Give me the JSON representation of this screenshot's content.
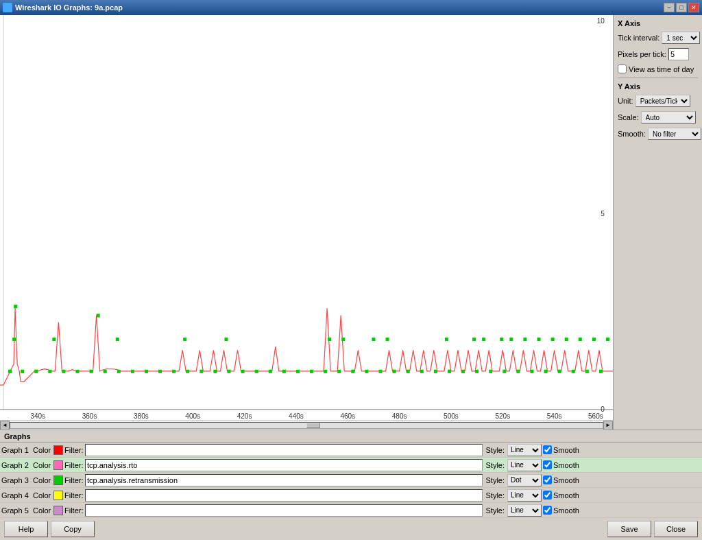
{
  "titleBar": {
    "title": "Wireshark IO Graphs: 9a.pcap",
    "minBtn": "−",
    "maxBtn": "□",
    "closeBtn": "✕"
  },
  "chart": {
    "xAxisLabels": [
      "340s",
      "360s",
      "380s",
      "400s",
      "420s",
      "440s",
      "460s",
      "480s",
      "500s",
      "520s",
      "540s",
      "560s"
    ],
    "yAxisLabels": [
      "10",
      "5",
      "0"
    ]
  },
  "rightPanel": {
    "xAxisTitle": "X Axis",
    "tickIntervalLabel": "Tick interval:",
    "tickIntervalValue": "1 sec",
    "pixelsPerTickLabel": "Pixels per tick:",
    "pixelsPerTickValue": "5",
    "viewAsTimeOfDayLabel": "View as time of day",
    "yAxisTitle": "Y Axis",
    "unitLabel": "Unit:",
    "unitValue": "Packets/Tick",
    "scaleLabel": "Scale:",
    "scaleValue": "Auto",
    "smoothLabel": "Smooth:",
    "smoothValue": "No filter"
  },
  "graphsSection": {
    "title": "Graphs",
    "graphs": [
      {
        "label": "Graph 1",
        "colorLabel": "Color",
        "filterLabel": "Filter:",
        "filterValue": "",
        "styleLabel": "Style:",
        "styleValue": "Line",
        "smoothLabel": "Smooth",
        "smoothChecked": true,
        "colorHex": "#ff0000",
        "selected": false
      },
      {
        "label": "Graph 2",
        "colorLabel": "Color",
        "filterLabel": "Filter:",
        "filterValue": "tcp.analysis.rto",
        "styleLabel": "Style:",
        "styleValue": "Line",
        "smoothLabel": "Smooth",
        "smoothChecked": true,
        "colorHex": "#ff69b4",
        "selected": true
      },
      {
        "label": "Graph 3",
        "colorLabel": "Color",
        "filterLabel": "Filter:",
        "filterValue": "tcp.analysis.retransmission",
        "styleLabel": "Style:",
        "styleValue": "Dot",
        "smoothLabel": "Smooth",
        "smoothChecked": true,
        "colorHex": "#00cc00",
        "selected": false
      },
      {
        "label": "Graph 4",
        "colorLabel": "Color",
        "filterLabel": "Filter:",
        "filterValue": "",
        "styleLabel": "Style:",
        "styleValue": "Line",
        "smoothLabel": "Smooth",
        "smoothChecked": true,
        "colorHex": "#ffff00",
        "selected": false
      },
      {
        "label": "Graph 5",
        "colorLabel": "Color",
        "filterLabel": "Filter:",
        "filterValue": "",
        "styleLabel": "Style:",
        "styleValue": "Line",
        "smoothLabel": "Smooth",
        "smoothChecked": true,
        "colorHex": "#cc88cc",
        "selected": false
      }
    ]
  },
  "buttons": {
    "help": "Help",
    "copy": "Copy",
    "save": "Save",
    "close": "Close"
  }
}
